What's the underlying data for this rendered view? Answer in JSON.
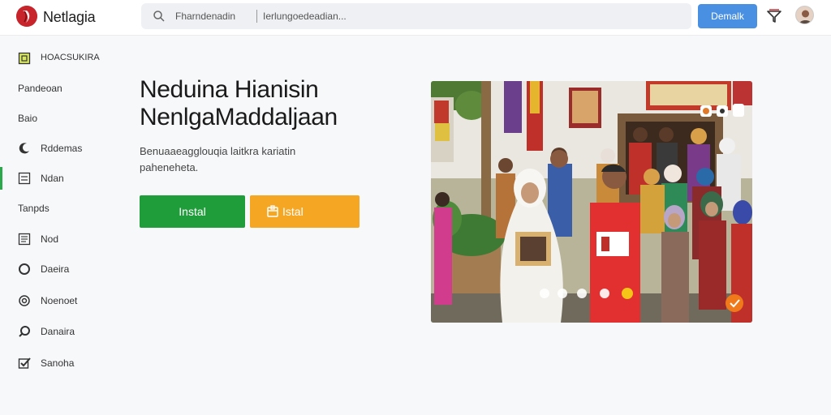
{
  "header": {
    "app_title": "Netlagia",
    "search_placeholder": "Fharndenadin",
    "search_secondary": "Ierlungoedeadian...",
    "action_button": "Demalk"
  },
  "sidebar": {
    "items": [
      {
        "label": "HOACSUKIRA",
        "icon": "square-icon"
      },
      {
        "label": "Pandeoan",
        "icon": ""
      },
      {
        "label": "Baio",
        "icon": ""
      },
      {
        "label": "Rddemas",
        "icon": "crescent-icon"
      },
      {
        "label": "Ndan",
        "icon": "grid-icon"
      },
      {
        "label": "Tanpds",
        "icon": ""
      },
      {
        "label": "Nod",
        "icon": "list-icon"
      },
      {
        "label": "Daeira",
        "icon": "circle-icon"
      },
      {
        "label": "Noenoet",
        "icon": "target-icon"
      },
      {
        "label": "Danaira",
        "icon": "search-icon"
      },
      {
        "label": "Sanoha",
        "icon": "checkbox-icon"
      }
    ],
    "active_index": 4
  },
  "hero": {
    "title_line1": "Neduina Hianisin",
    "title_line2": "NenlgaMaddaljaan",
    "description": "Benuaaeagglouqia laitkra kariatin paheneheta.",
    "primary_button": "Instal",
    "secondary_button": "Istal"
  },
  "colors": {
    "accent_blue": "#4a90e2",
    "primary_green": "#1f9d3a",
    "secondary_orange": "#f5a623",
    "logo_red": "#c8242b"
  }
}
